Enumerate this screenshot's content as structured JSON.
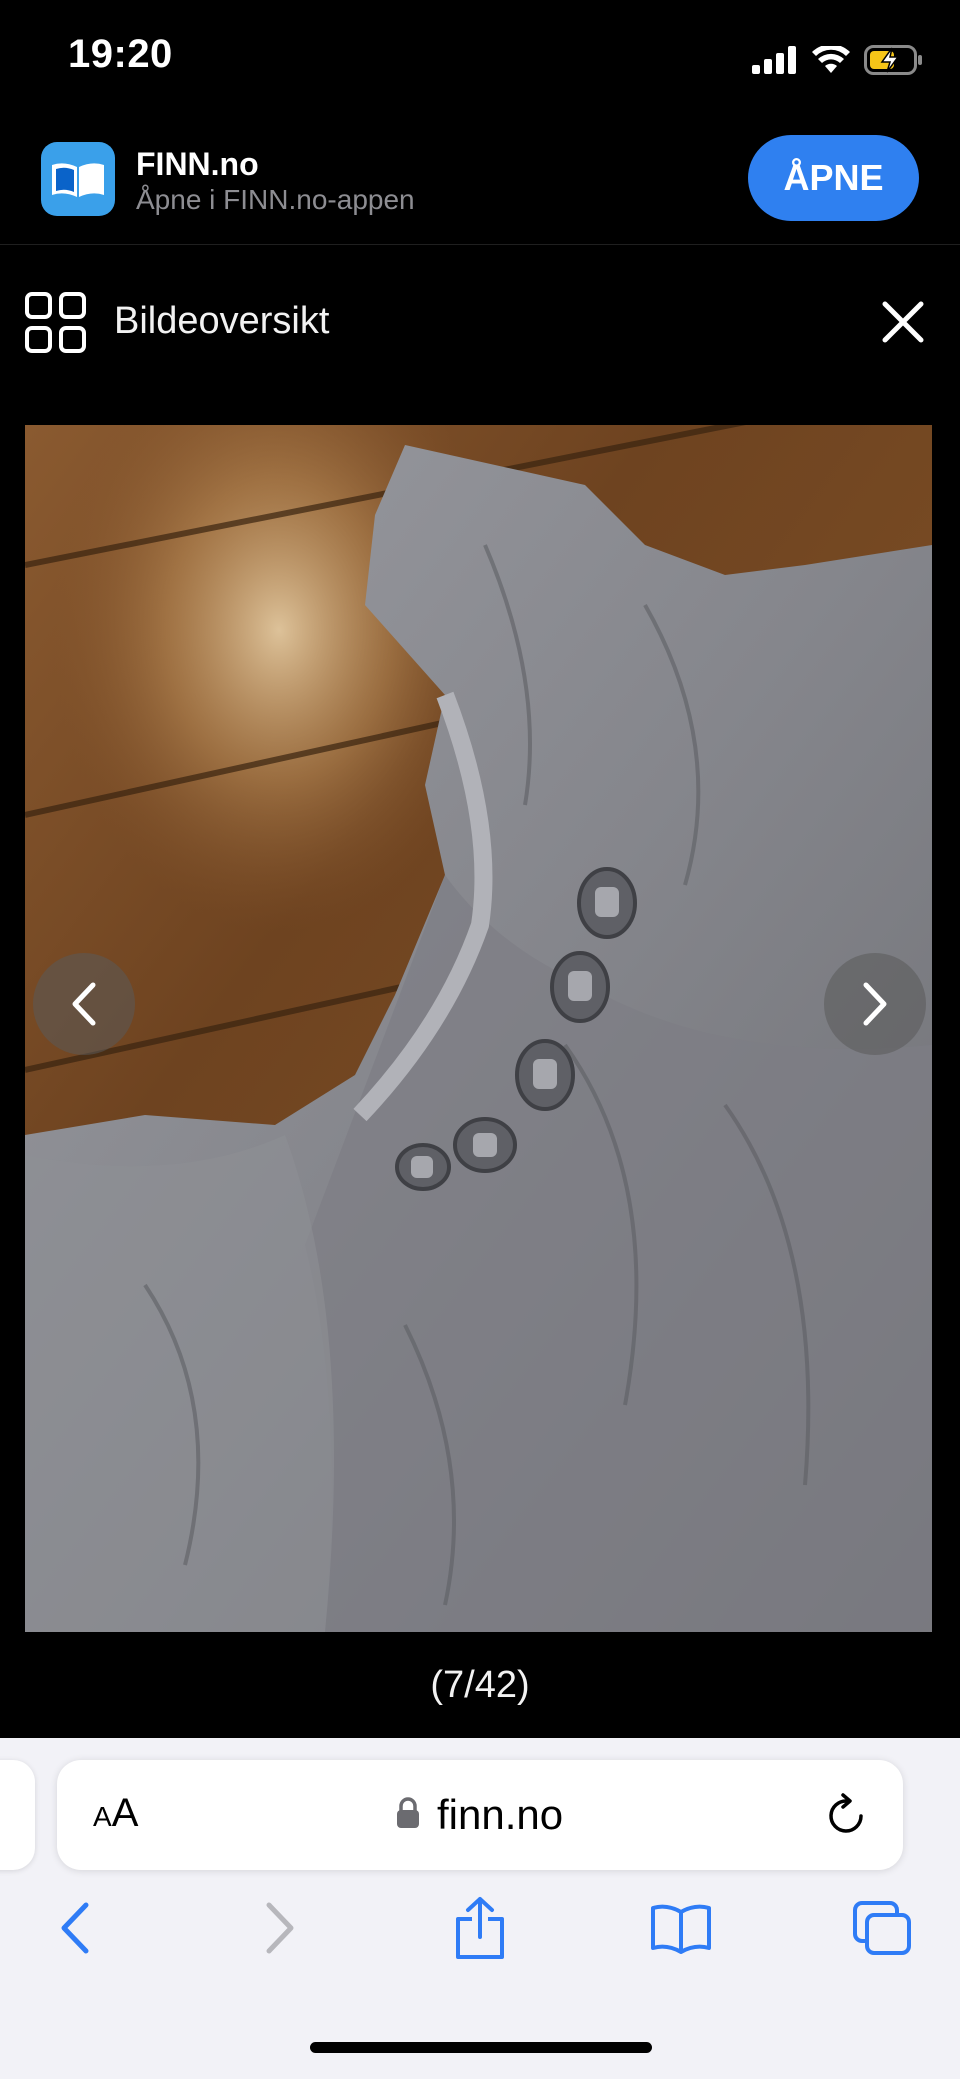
{
  "status_bar": {
    "time": "19:20",
    "icons": [
      "cellular-signal-icon",
      "wifi-icon",
      "battery-charging-icon"
    ]
  },
  "app_banner": {
    "name": "FINN.no",
    "subtitle": "Åpne i FINN.no-appen",
    "open_label": "ÅPNE"
  },
  "gallery": {
    "title": "Bildeoversikt",
    "counter": "(7/42)"
  },
  "browser": {
    "reader_small": "A",
    "reader_big": "A",
    "url": "finn.no"
  },
  "colors": {
    "accent": "#2f80f0",
    "safari_blue": "#2f7cf6",
    "app_icon": "#3aa0ea",
    "background": "#000000",
    "toolbar_bg": "#f2f2f7"
  }
}
